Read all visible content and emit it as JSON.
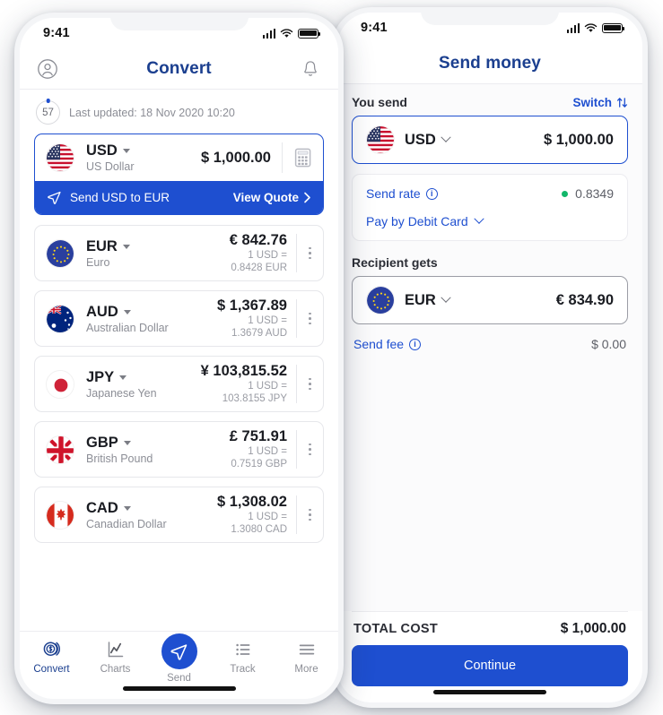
{
  "theme": {
    "brand_blue": "#1e4fd0",
    "title_blue": "#1b3f8f",
    "green": "#12b76a",
    "muted": "#8c8e96"
  },
  "left_phone": {
    "status": {
      "time": "9:41",
      "signal_icon": "cellular-bars-icon",
      "wifi_icon": "wifi-icon",
      "battery_icon": "battery-icon"
    },
    "header": {
      "title": "Convert",
      "profile_icon": "profile-icon",
      "bell_icon": "bell-icon"
    },
    "refresh": {
      "seconds": "57",
      "updated_text": "Last updated: 18 Nov 2020 10:20"
    },
    "base": {
      "code": "USD",
      "name": "US Dollar",
      "amount": "$ 1,000.00",
      "flag": "us-flag-icon",
      "calculator_icon": "calculator-icon",
      "banner_text": "Send USD to EUR",
      "banner_action": "View Quote",
      "banner_icon": "send-paper-plane-icon",
      "banner_chevron": "chevron-right-icon"
    },
    "rates": [
      {
        "code": "EUR",
        "name": "Euro",
        "amount": "€ 842.76",
        "rate_line1": "1 USD =",
        "rate_line2": "0.8428 EUR",
        "flag": "eu-flag-icon"
      },
      {
        "code": "AUD",
        "name": "Australian Dollar",
        "amount": "$ 1,367.89",
        "rate_line1": "1 USD =",
        "rate_line2": "1.3679 AUD",
        "flag": "au-flag-icon"
      },
      {
        "code": "JPY",
        "name": "Japanese Yen",
        "amount": "¥ 103,815.52",
        "rate_line1": "1 USD =",
        "rate_line2": "103.8155 JPY",
        "flag": "jp-flag-icon"
      },
      {
        "code": "GBP",
        "name": "British Pound",
        "amount": "£ 751.91",
        "rate_line1": "1 USD =",
        "rate_line2": "0.7519 GBP",
        "flag": "gb-flag-icon"
      },
      {
        "code": "CAD",
        "name": "Canadian Dollar",
        "amount": "$ 1,308.02",
        "rate_line1": "1 USD =",
        "rate_line2": "1.3080 CAD",
        "flag": "ca-flag-icon"
      }
    ],
    "tabs": [
      {
        "label": "Convert",
        "icon": "coins-icon",
        "active": true
      },
      {
        "label": "Charts",
        "icon": "line-chart-icon",
        "active": false
      },
      {
        "label": "Send",
        "icon": "send-paper-plane-icon",
        "active": false
      },
      {
        "label": "Track",
        "icon": "list-icon",
        "active": false
      },
      {
        "label": "More",
        "icon": "hamburger-icon",
        "active": false
      }
    ]
  },
  "right_phone": {
    "status": {
      "time": "9:41"
    },
    "header": {
      "title": "Send money"
    },
    "you_send": {
      "label": "You send",
      "switch_label": "Switch",
      "switch_icon": "swap-arrows-icon",
      "code": "USD",
      "flag": "us-flag-icon",
      "amount": "$ 1,000.00"
    },
    "rate_card": {
      "rate_label": "Send rate",
      "rate_value": "0.8349",
      "pay_method": "Pay by Debit Card",
      "info_icon": "info-icon",
      "status_dot": "green-status-dot"
    },
    "recipient": {
      "label": "Recipient gets",
      "code": "EUR",
      "flag": "eu-flag-icon",
      "amount": "€ 834.90"
    },
    "fee": {
      "label": "Send fee",
      "value": "$ 0.00"
    },
    "total": {
      "label": "TOTAL COST",
      "value": "$ 1,000.00"
    },
    "cta": {
      "label": "Continue"
    }
  }
}
